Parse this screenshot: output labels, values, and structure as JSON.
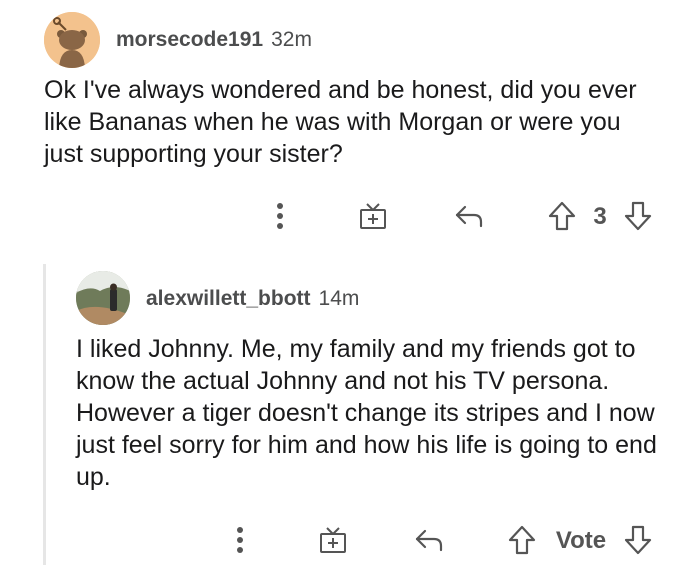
{
  "comments": [
    {
      "username": "morsecode191",
      "timestamp": "32m",
      "body": "Ok I've always wondered and be honest, did you ever like Bananas when he was with Morgan or were you just supporting your sister?",
      "vote_label": "3"
    },
    {
      "username": "alexwillett_bbott",
      "timestamp": "14m",
      "body": "I liked Johnny. Me, my family and my friends got to know the actual Johnny and not his TV persona. However a tiger doesn't change its stripes and I now just feel sorry for him and how his life is going to end up.",
      "vote_label": "Vote"
    }
  ],
  "icons": {
    "more": "more-options-icon",
    "gift": "gift-award-icon",
    "reply": "reply-icon",
    "upvote": "upvote-arrow-icon",
    "downvote": "downvote-arrow-icon"
  },
  "colors": {
    "text": "#1a1a1b",
    "meta": "#4c4d4e",
    "icon": "#555555",
    "snoo_bg": "#f3c28d",
    "thread_line": "#e6e6e6"
  }
}
